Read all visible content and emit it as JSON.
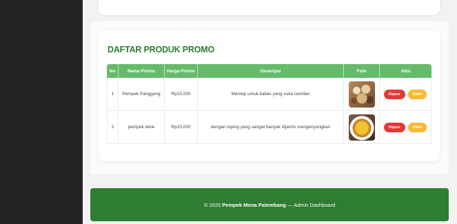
{
  "section": {
    "title": "DAFTAR PRODUK PROMO"
  },
  "table": {
    "headers": [
      "No",
      "Nama Promo",
      "Harga Promo",
      "Deskripsi",
      "Foto",
      "Aksi"
    ],
    "rows": [
      {
        "no": "1",
        "name": "Pempek Panggang",
        "price": "Rp15,000",
        "description": "Mantap untuk kalian yang suka cemilan",
        "photo_icon": "pempek-panggang-photo"
      },
      {
        "no": "2",
        "name": "pempek telok",
        "price": "Rp20,000",
        "description": "dengan toping yang sangat banyak dijamin mengenyangkan",
        "photo_icon": "pempek-telok-photo"
      }
    ],
    "actions": {
      "delete_label": "Hapus",
      "edit_label": "Ubah"
    }
  },
  "footer": {
    "prefix": "© 2025",
    "brand": "Pempek Mona Palembang",
    "suffix": "— Admin Dashboard"
  },
  "colors": {
    "sidebar": "#232323",
    "header_green": "#66bb6a",
    "footer_green": "#2e7d32",
    "title_green": "#2e7d32",
    "delete": "#e53935",
    "edit": "#f9b931"
  }
}
